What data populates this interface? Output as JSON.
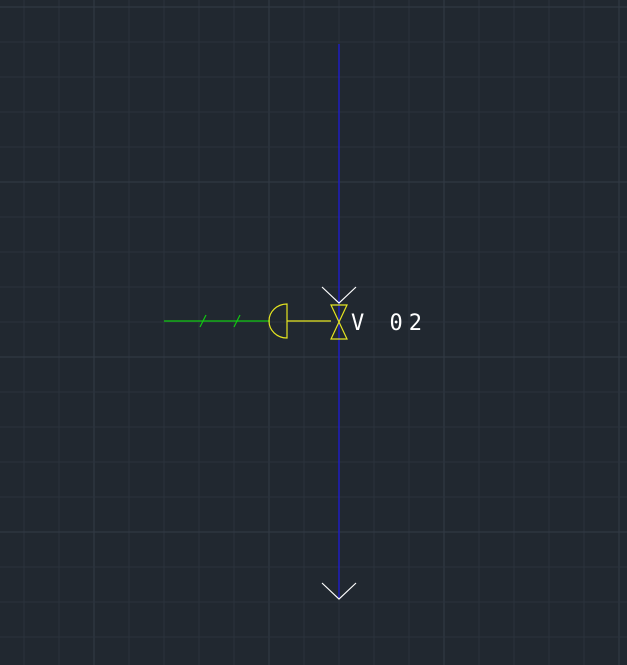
{
  "drawing": {
    "background_color": "#212830",
    "grid_minor_color": "#2a323c",
    "grid_major_color": "#323b46",
    "grid_visible": true,
    "instrument_tag": "V 02",
    "colors": {
      "pipe": "#1f1fb8",
      "signal_line": "#11c811",
      "actuator": "#e6e620",
      "flow_arrow": "#ffffff",
      "tag_text": "#ffffff"
    },
    "icons": {
      "actuator": "diaphragm-actuator-icon",
      "valve": "gate-valve-icon",
      "arrow": "arrow-down-icon"
    }
  }
}
